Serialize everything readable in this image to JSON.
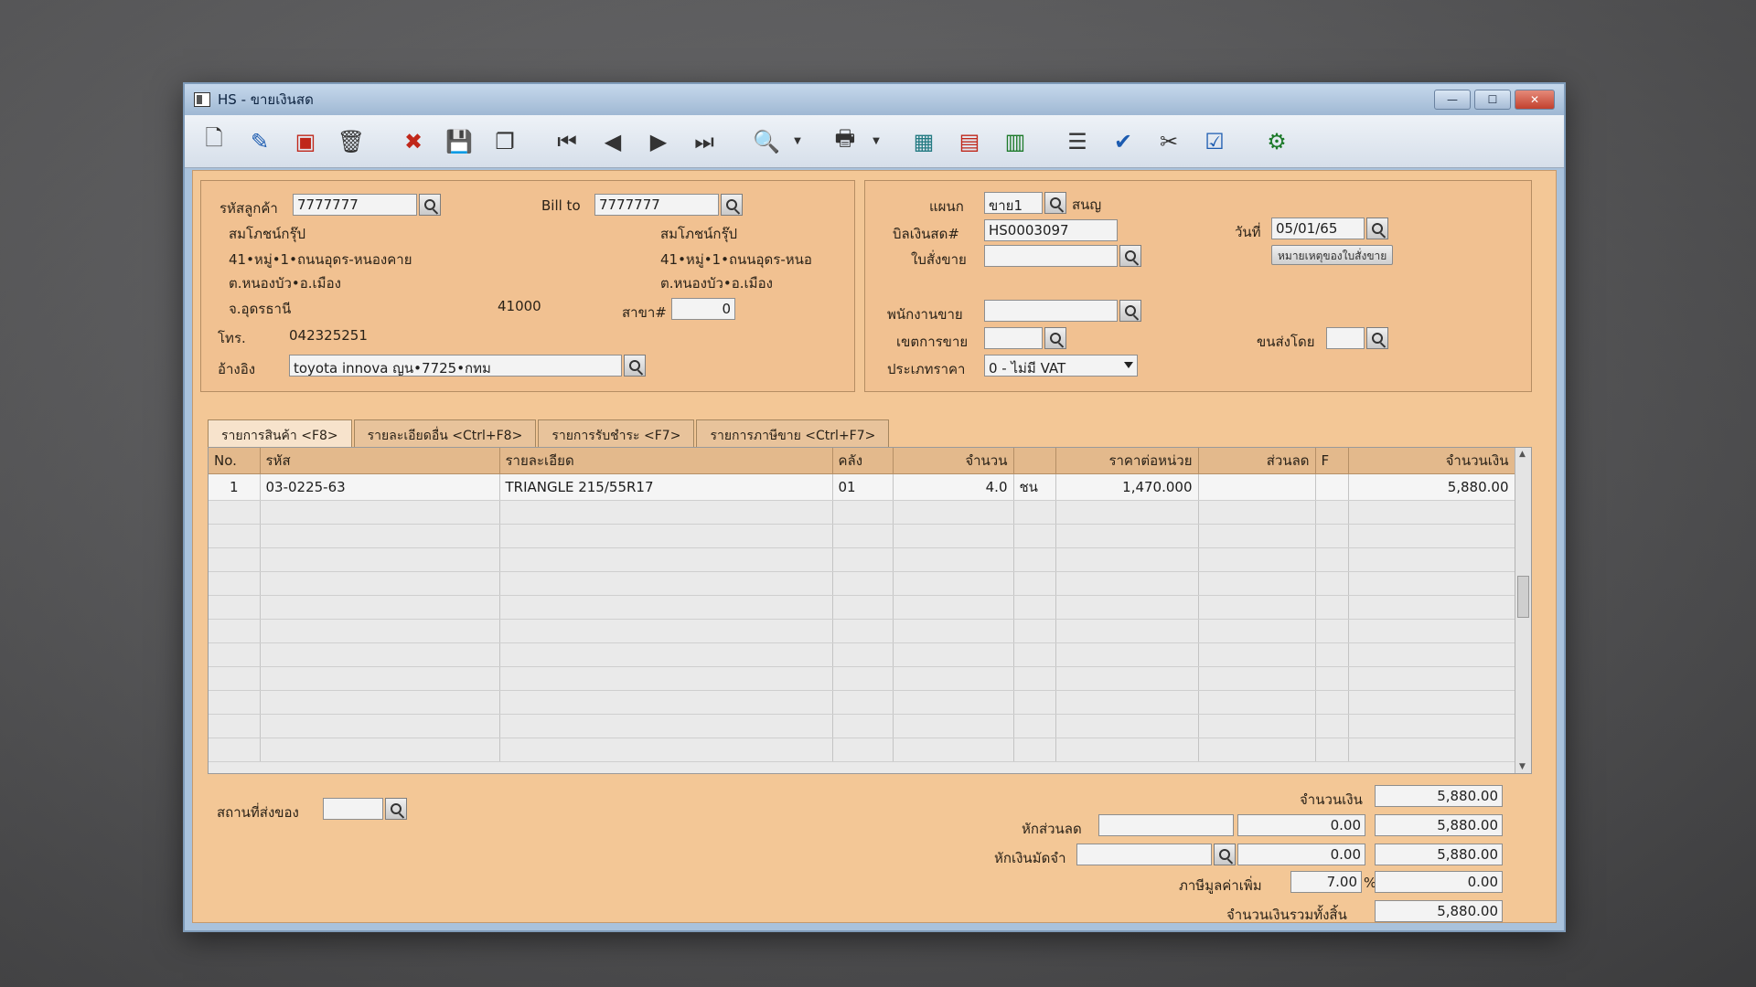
{
  "window": {
    "title": "HS - ขายเงินสด",
    "controls": {
      "minimize": "—",
      "maximize": "☐",
      "close": "✕"
    }
  },
  "toolbar": {
    "icons": [
      "new-doc-icon",
      "edit-icon",
      "void-icon",
      "trash-icon",
      "cancel-icon",
      "save-icon",
      "copy-icon",
      "first-record-icon",
      "prev-record-icon",
      "next-record-icon",
      "last-record-icon",
      "find-icon",
      "print-icon",
      "calculator-icon",
      "register-icon",
      "export-icon",
      "report-icon",
      "approve-icon",
      "tools-icon",
      "confirm-icon",
      "settings-icon"
    ]
  },
  "customer": {
    "code_label": "รหัสลูกค้า",
    "code": "7777777",
    "name": "สมโภชน์กรุ๊ป",
    "addr1": "41•หมู่•1•ถนนอุดร-หนองคาย",
    "addr2": "ต.หนองบัว•อ.เมือง",
    "province": "จ.อุดรธานี",
    "zip": "41000",
    "phone_label": "โทร.",
    "phone": "042325251",
    "ref_label": "อ้างอิง",
    "ref": "toyota innova ญน•7725•กทม"
  },
  "billto": {
    "label": "Bill to",
    "code": "7777777",
    "name": "สมโภชน์กรุ๊ป",
    "addr1": "41•หมู่•1•ถนนอุดร-หนอ",
    "addr2": "ต.หนองบัว•อ.เมือง",
    "branch_label": "สาขา#",
    "branch": "0"
  },
  "docinfo": {
    "dept_label": "แผนก",
    "dept": "ขาย1",
    "dept_name": "สนญ",
    "bill_label": "บิลเงินสด#",
    "bill": "HS0003097",
    "date_label": "วันที่",
    "date": "05/01/65",
    "so_label": "ใบสั่งขาย",
    "so": "",
    "so_note_btn": "หมายเหตุของใบสั่งขาย",
    "salesman_label": "พนักงานขาย",
    "salesman": "",
    "area_label": "เขตการขาย",
    "area": "",
    "ship_label": "ขนส่งโดย",
    "ship": "",
    "pricetype_label": "ประเภทราคา",
    "pricetype": "0 - ไม่มี VAT"
  },
  "tabs": [
    "รายการสินค้า <F8>",
    "รายละเอียดอื่น <Ctrl+F8>",
    "รายการรับชำระ <F7>",
    "รายการภาษีขาย <Ctrl+F7>"
  ],
  "grid": {
    "headers": [
      "No.",
      "รหัส",
      "รายละเอียด",
      "คลัง",
      "จำนวน",
      "",
      "ราคาต่อหน่วย",
      "ส่วนลด",
      "F",
      "จำนวนเงิน"
    ],
    "rows": [
      [
        "1",
        "03-0225-63",
        "TRIANGLE 215/55R17",
        "01",
        "4.0",
        "ชน",
        "1,470.000",
        "",
        "",
        "5,880.00"
      ]
    ]
  },
  "footer": {
    "delivery_label": "สถานที่ส่งของ",
    "delivery": "",
    "amount_label": "จำนวนเงิน",
    "amount": "5,880.00",
    "discount_label": "หักส่วนลด",
    "discount_text": "",
    "discount_value": "0.00",
    "after_discount": "5,880.00",
    "deposit_label": "หักเงินมัดจำ",
    "deposit_text": "",
    "deposit_value": "0.00",
    "after_deposit": "5,880.00",
    "vat_label": "ภาษีมูลค่าเพิ่ม",
    "vat_rate": "7.00",
    "vat_unit": "%",
    "vat_amount": "0.00",
    "total_label": "จำนวนเงินรวมทั้งสิ้น",
    "total": "5,880.00"
  }
}
